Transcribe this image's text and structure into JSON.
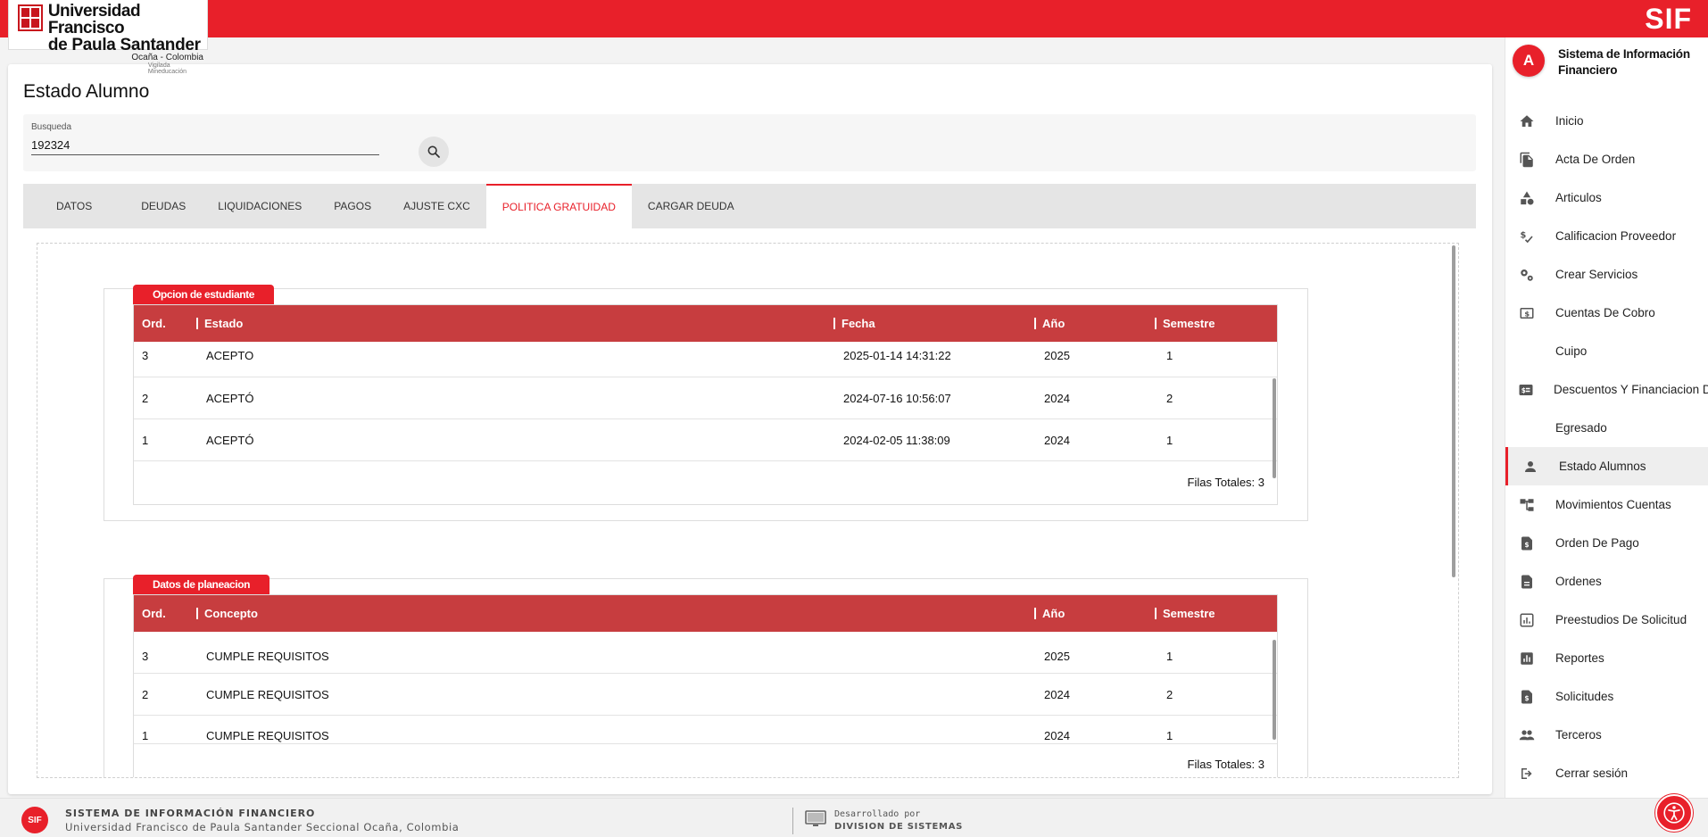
{
  "header": {
    "logo": {
      "line1": "Universidad Francisco",
      "line2": "de Paula Santander",
      "line3": "Ocaña - Colombia",
      "line4": "Vigilada Mineducación"
    },
    "brand": "SIF",
    "accent_color": "#e8202a"
  },
  "page": {
    "title": "Estado Alumno",
    "search": {
      "label": "Busqueda",
      "value": "192324",
      "button_icon": "search-icon"
    }
  },
  "tabs": [
    {
      "label": "DATOS",
      "active": false
    },
    {
      "label": "DEUDAS",
      "active": false
    },
    {
      "label": "LIQUIDACIONES",
      "active": false
    },
    {
      "label": "PAGOS",
      "active": false
    },
    {
      "label": "AJUSTE CXC",
      "active": false
    },
    {
      "label": "POLITICA GRATUIDAD",
      "active": true
    },
    {
      "label": "CARGAR DEUDA",
      "active": false
    }
  ],
  "section1": {
    "badge": "Opcion de estudiante",
    "columns": [
      "Ord.",
      "Estado",
      "Fecha",
      "Año",
      "Semestre"
    ],
    "rows": [
      [
        "3",
        "ACEPTO",
        "2025-01-14 14:31:22",
        "2025",
        "1"
      ],
      [
        "2",
        "ACEPTÓ",
        "2024-07-16 10:56:07",
        "2024",
        "2"
      ],
      [
        "1",
        "ACEPTÓ",
        "2024-02-05 11:38:09",
        "2024",
        "1"
      ]
    ],
    "footer": "Filas Totales: 3"
  },
  "section2": {
    "badge": "Datos de planeacion",
    "columns": [
      "Ord.",
      "Concepto",
      "Año",
      "Semestre"
    ],
    "rows": [
      [
        "3",
        "CUMPLE REQUISITOS",
        "2025",
        "1"
      ],
      [
        "2",
        "CUMPLE REQUISITOS",
        "2024",
        "2"
      ],
      [
        "1",
        "CUMPLE REQUISITOS",
        "2024",
        "1"
      ]
    ],
    "footer": "Filas Totales: 3"
  },
  "sidebar": {
    "avatar_letter": "A",
    "title_line1": "Sistema de Información",
    "title_line2": "Financiero",
    "items": [
      {
        "label": "Inicio",
        "icon": "home-icon",
        "active": false
      },
      {
        "label": "Acta De Orden",
        "icon": "document-copy-icon",
        "active": false
      },
      {
        "label": "Articulos",
        "icon": "shapes-icon",
        "active": false
      },
      {
        "label": "Calificacion Proveedor",
        "icon": "rating-icon",
        "active": false
      },
      {
        "label": "Crear Servicios",
        "icon": "gears-icon",
        "active": false
      },
      {
        "label": "Cuentas De Cobro",
        "icon": "money-icon",
        "active": false
      },
      {
        "label": "Cuipo",
        "icon": "",
        "active": false
      },
      {
        "label": "Descuentos Y Financiacion De",
        "icon": "discount-icon",
        "active": false
      },
      {
        "label": "Egresado",
        "icon": "",
        "active": false
      },
      {
        "label": "Estado Alumnos",
        "icon": "person-icon",
        "active": true
      },
      {
        "label": "Movimientos Cuentas",
        "icon": "account-tree-icon",
        "active": false
      },
      {
        "label": "Orden De Pago",
        "icon": "payment-doc-icon",
        "active": false
      },
      {
        "label": "Ordenes",
        "icon": "description-icon",
        "active": false
      },
      {
        "label": "Preestudios De Solicitud",
        "icon": "bar-chart-icon",
        "active": false
      },
      {
        "label": "Reportes",
        "icon": "report-icon",
        "active": false
      },
      {
        "label": "Solicitudes",
        "icon": "request-doc-icon",
        "active": false
      },
      {
        "label": "Terceros",
        "icon": "people-icon",
        "active": false
      },
      {
        "label": "Cerrar sesión",
        "icon": "logout-icon",
        "active": false
      }
    ]
  },
  "footer": {
    "logo_text": "SIF",
    "title": "SISTEMA DE INFORMACIÓN FINANCIERO",
    "subtitle": "Universidad Francisco de Paula Santander Seccional Ocaña, Colombia",
    "dev_line1": "Desarrollado por",
    "dev_line2": "DIVISION DE SISTEMAS"
  },
  "accessibility_button_icon": "accessibility-icon"
}
